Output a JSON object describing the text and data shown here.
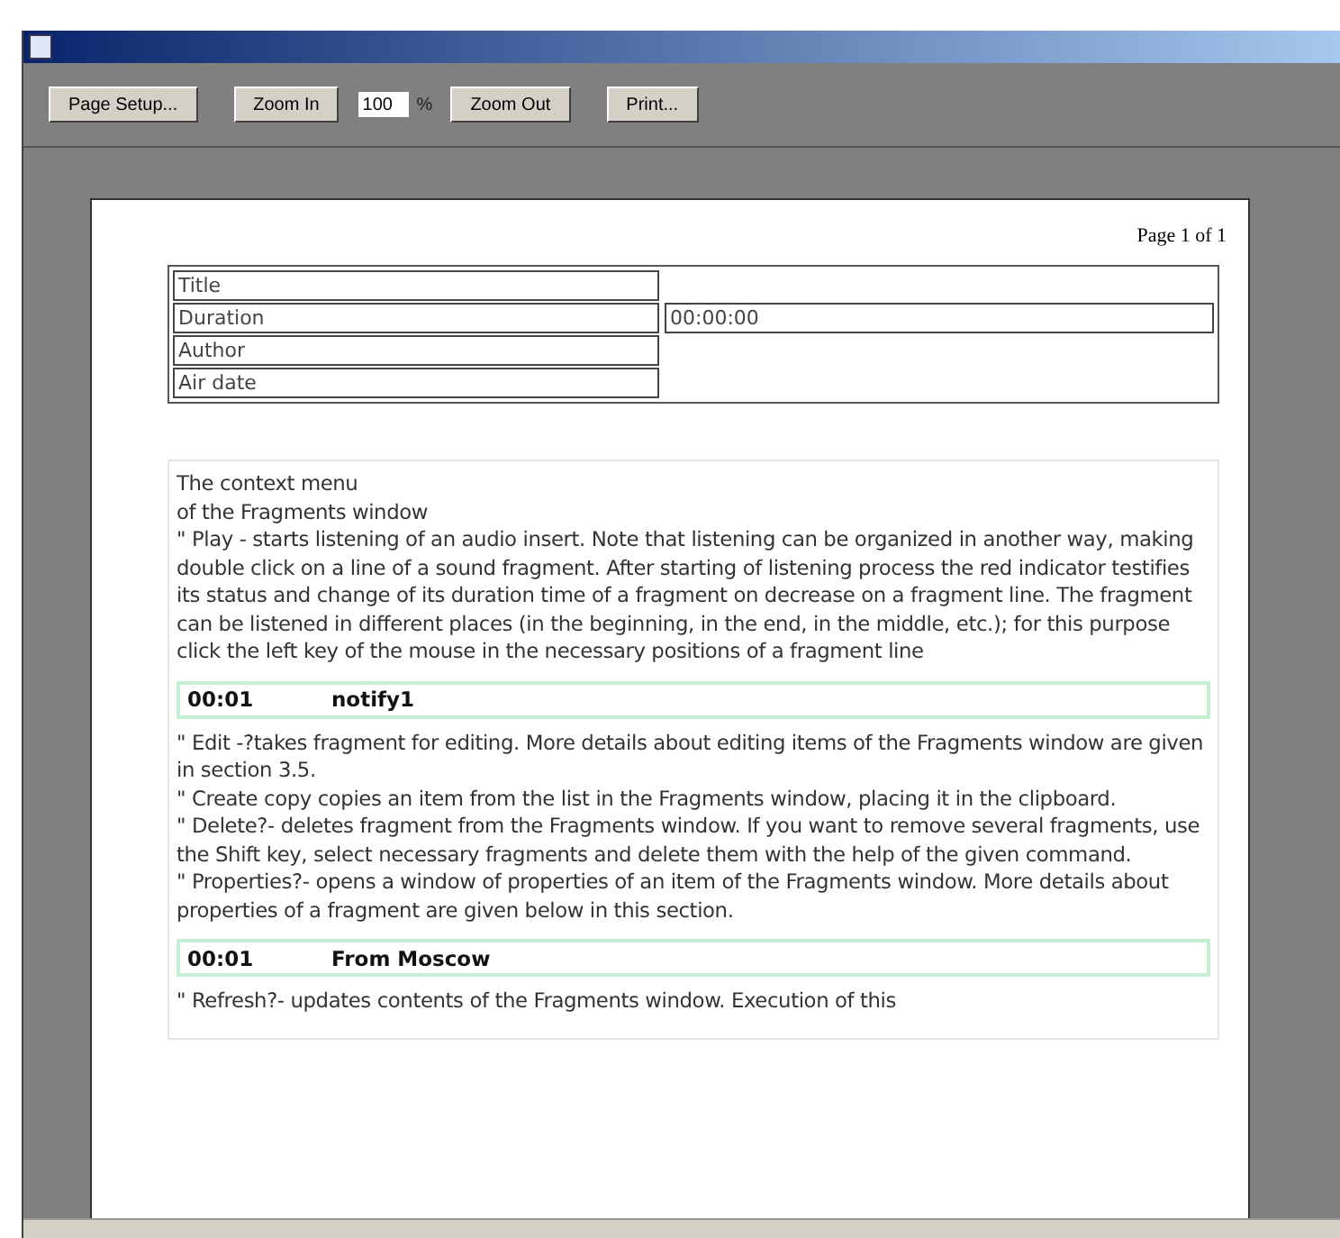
{
  "toolbar": {
    "buttons": [
      {
        "label": "Page Setup...",
        "kind": "button"
      },
      {
        "label": "Zoom In",
        "kind": "button"
      },
      {
        "label": "100",
        "kind": "field"
      },
      {
        "label": "%",
        "kind": "unit"
      },
      {
        "label": "Zoom Out",
        "kind": "button"
      },
      {
        "label": "Print...",
        "kind": "button"
      }
    ]
  },
  "page": {
    "page_number": "Page 1 of 1",
    "fields": [
      {
        "label": "Title"
      },
      {
        "label": "Duration",
        "value": "00:00:00"
      },
      {
        "label": "Author"
      },
      {
        "label": "Air date"
      }
    ],
    "blocks": [
      {
        "kind": "text",
        "lines": [
          "The context menu",
          "of the Fragments window",
          "\" Play - starts listening of an audio insert. Note that listening can be organized in another way, making double click on a line of a sound fragment. After starting of listening process the red indicator testifies its status and change of its duration time of a fragment on decrease on a fragment line. The fragment can be listened in different places (in the beginning, in the end, in the middle, etc.); for this purpose click the left key of the mouse in the necessary positions of a fragment line"
        ]
      },
      {
        "kind": "fragment",
        "time": "00:01",
        "name": "notify1"
      },
      {
        "kind": "text",
        "lines": [
          "\" Edit -?takes fragment for editing. More details about editing items of the Fragments window are given in section 3.5.",
          "\" Create copy copies an item from the list in the Fragments window, placing it in the clipboard.",
          "\" Delete?- deletes fragment from the Fragments window. If you want to remove several fragments, use the Shift key, select necessary fragments and delete them with the help of the given command.",
          "\" Properties?- opens a window of properties of an item of the Fragments window. More details about properties of a fragment are given below in this section."
        ]
      },
      {
        "kind": "fragment",
        "time": "00:01",
        "name": "From Moscow"
      },
      {
        "kind": "text",
        "lines": [
          "\" Refresh?- updates contents of the Fragments window. Execution of this"
        ]
      }
    ]
  }
}
